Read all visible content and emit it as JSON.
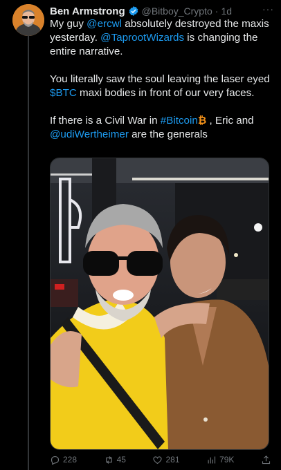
{
  "tweet": {
    "author_name": "Ben Armstrong",
    "author_handle": "@Bitboy_Crypto",
    "time": "1d",
    "more": "···",
    "para1": {
      "t1": "My guy ",
      "m1": "@ercwl",
      "t2": " absolutely destroyed the maxis yesterday. ",
      "m2": "@TaprootWizards",
      "t3": " is changing the entire narrative."
    },
    "para2": {
      "t1": "You literally saw the soul leaving the laser eyed ",
      "cashtag": "$BTC",
      "t2": " maxi bodies in front of our very faces."
    },
    "para3": {
      "t1": "If there is a Civil War in ",
      "hashtag": "#Bitcoin",
      "btc_icon": "₿",
      "t2": " , Eric and ",
      "m1": "@udiWertheimer",
      "t3": " are the generals"
    }
  },
  "actions": {
    "replies": "228",
    "reposts": "45",
    "likes": "281",
    "views": "79K"
  },
  "icons": [
    "verified-badge-icon",
    "more-icon",
    "reply-icon",
    "repost-icon",
    "like-icon",
    "views-icon",
    "share-icon"
  ],
  "colors": {
    "background": "#000000",
    "text": "#e7e9ea",
    "muted": "#71767b",
    "link": "#1d9bf0",
    "bitcoin": "#f7931a",
    "avatar_bg": "#d9822b"
  }
}
